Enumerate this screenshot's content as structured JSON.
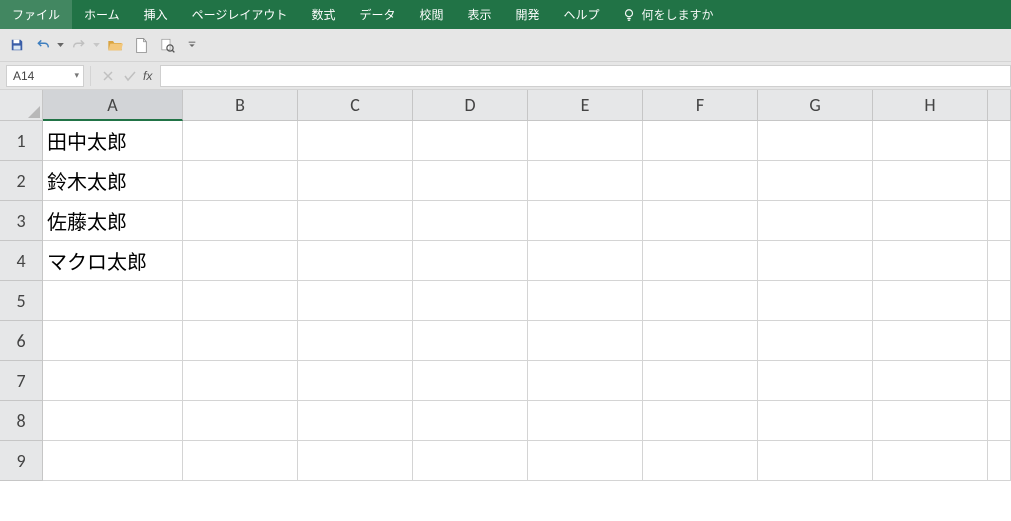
{
  "ribbon": {
    "tabs": [
      "ファイル",
      "ホーム",
      "挿入",
      "ページレイアウト",
      "数式",
      "データ",
      "校閲",
      "表示",
      "開発",
      "ヘルプ"
    ],
    "tellme_placeholder": "何をしますか"
  },
  "qat": {
    "save": "保存",
    "undo": "元に戻す",
    "redo": "やり直し",
    "open": "開く",
    "new": "新規",
    "preview": "印刷プレビュー"
  },
  "formula_bar": {
    "namebox_value": "A14",
    "cancel": "×",
    "enter": "✓",
    "fx_label": "fx",
    "formula_value": ""
  },
  "columns": [
    "A",
    "B",
    "C",
    "D",
    "E",
    "F",
    "G",
    "H"
  ],
  "row_headers": [
    "1",
    "2",
    "3",
    "4",
    "5",
    "6",
    "7",
    "8",
    "9"
  ],
  "cells": {
    "A1": "田中太郎",
    "A2": "鈴木太郎",
    "A3": "佐藤太郎",
    "A4": "マクロ太郎"
  },
  "active_column": "A"
}
